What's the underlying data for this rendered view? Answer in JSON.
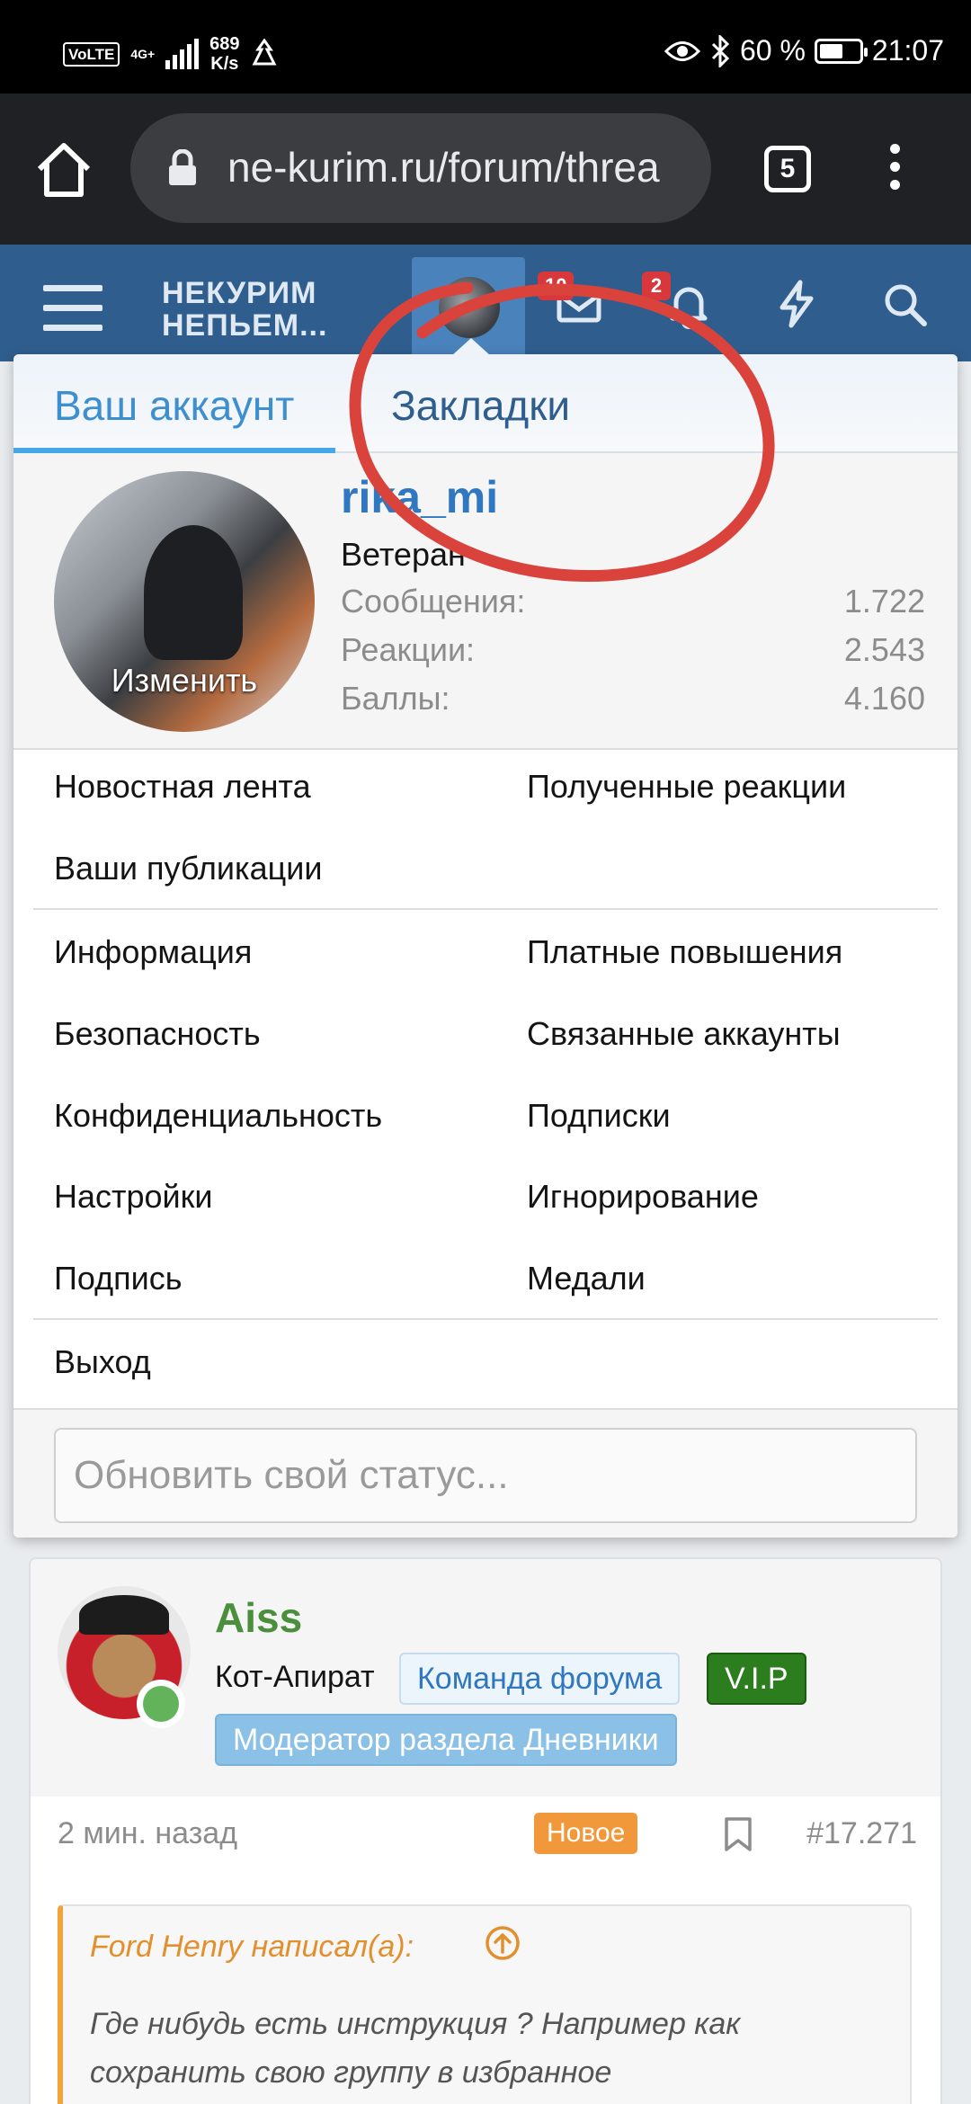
{
  "status_bar": {
    "volte": "VoLTE",
    "network": "4G+",
    "speed_value": "689",
    "speed_unit": "K/s",
    "battery_percent": "60 %",
    "battery_level": 0.6,
    "time": "21:07"
  },
  "browser": {
    "url": "ne-kurim.ru/forum/threa",
    "tab_count": "5"
  },
  "forum_header": {
    "logo_line1": "НЕКУРИМ",
    "logo_line2": "НЕПЬЕМ...",
    "inbox_badge": "10",
    "alerts_badge": "2"
  },
  "account_menu": {
    "tabs": [
      {
        "label": "Ваш аккаунт"
      },
      {
        "label": "Закладки"
      }
    ],
    "username": "rika_mi",
    "user_title": "Ветеран",
    "avatar_edit": "Изменить",
    "stats": [
      {
        "label": "Сообщения:",
        "value": "1.722"
      },
      {
        "label": "Реакции:",
        "value": "2.543"
      },
      {
        "label": "Баллы:",
        "value": "4.160"
      }
    ],
    "links": {
      "news_feed": "Новостная лента",
      "received_reactions": "Полученные реакции",
      "your_posts": "Ваши публикации",
      "info": "Информация",
      "paid_upgrades": "Платные повышения",
      "security": "Безопасность",
      "connected_accounts": "Связанные аккаунты",
      "privacy": "Конфиденциальность",
      "subscriptions": "Подписки",
      "settings": "Настройки",
      "ignoring": "Игнорирование",
      "signature": "Подпись",
      "medals": "Медали",
      "logout": "Выход"
    },
    "status_placeholder": "Обновить свой статус..."
  },
  "post": {
    "author": "Aiss",
    "author_title": "Кот-Апират",
    "badges": {
      "team": "Команда форума",
      "vip": "V.I.P",
      "moderator": "Модератор раздела Дневники"
    },
    "time": "2 мин. назад",
    "new_label": "Новое",
    "number": "#17.271",
    "quote_author": "Ford Henry написал(а):",
    "quote_text": "Где нибудь есть инструкция ? Например как сохранить свою группу в избранное"
  },
  "colors": {
    "forum_header": "#2f5e8e",
    "accent_blue": "#47a7eb",
    "annotation_red": "#d9433b",
    "new_badge": "#f0983a",
    "vip_green": "#2c7d1d"
  }
}
